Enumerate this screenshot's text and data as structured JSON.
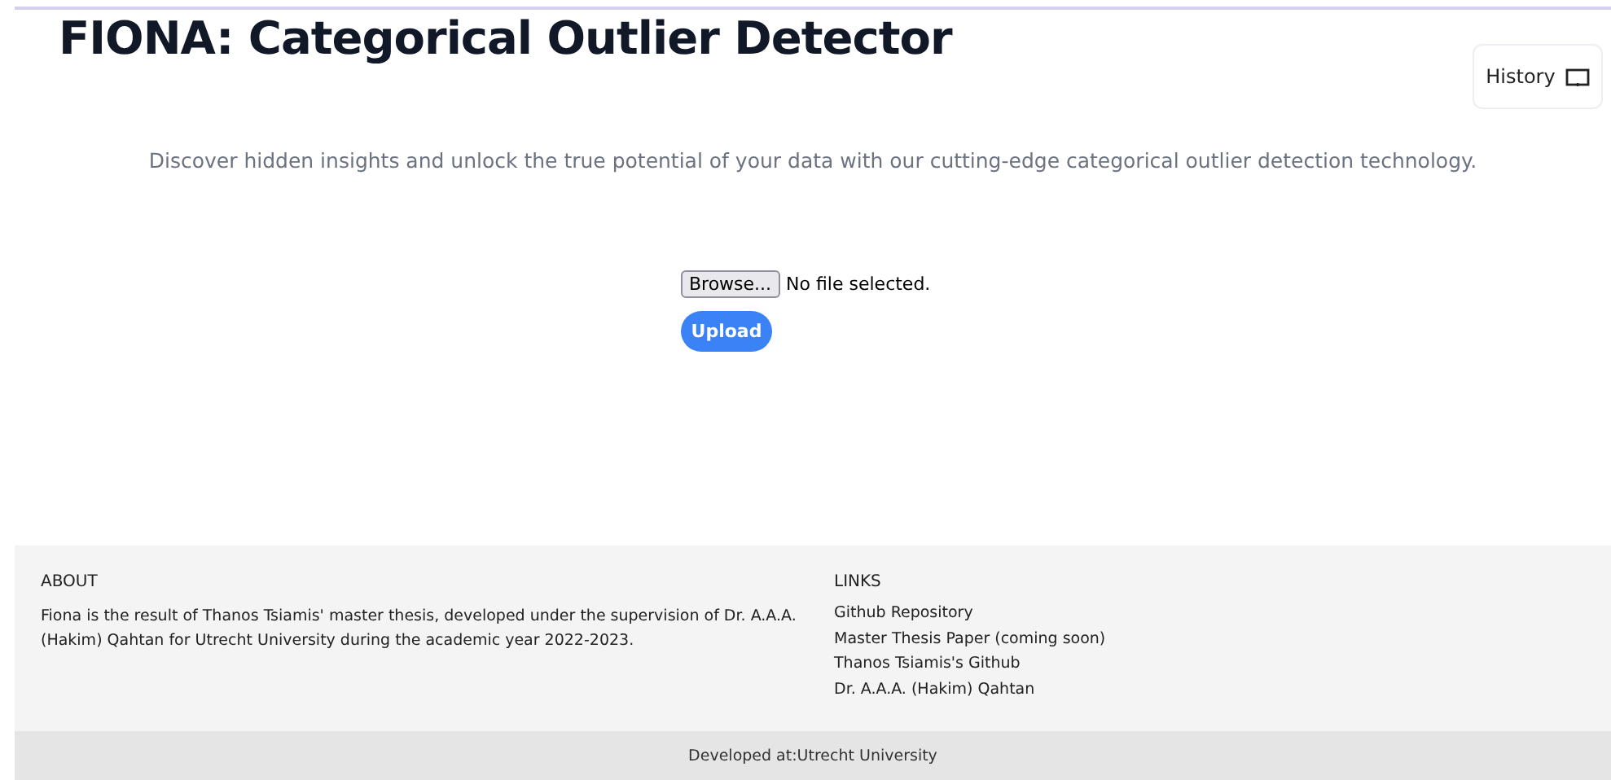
{
  "header": {
    "title": "FIONA: Categorical Outlier Detector",
    "history_button": "History"
  },
  "tagline": "Discover hidden insights and unlock the true potential of your data with our cutting-edge categorical outlier detection technology.",
  "upload": {
    "browse_button": "Browse...",
    "file_status": "No file selected.",
    "upload_button": "Upload"
  },
  "footer": {
    "about": {
      "heading": "ABOUT",
      "text": "Fiona is the result of Thanos Tsiamis' master thesis, developed under the supervision of Dr. A.A.A. (Hakim) Qahtan for Utrecht University during the academic year 2022-2023."
    },
    "links": {
      "heading": "LINKS",
      "items": [
        "Github Repository",
        "Master Thesis Paper (coming soon)",
        "Thanos Tsiamis's Github",
        "Dr. A.A.A. (Hakim) Qahtan"
      ]
    },
    "bottom_bar": "Developed at:Utrecht University"
  }
}
